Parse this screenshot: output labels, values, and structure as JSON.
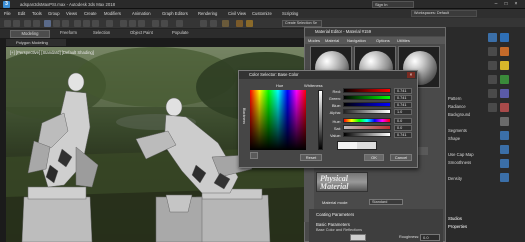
{
  "window": {
    "title": "adspan3dsMaxPSI.max - Autodesk 3ds Max 2018",
    "sign_in": "Sign In",
    "workspace": "Workspaces: Default",
    "controls": [
      "–",
      "□",
      "×"
    ]
  },
  "menu": [
    "File",
    "Edit",
    "Tools",
    "Group",
    "Views",
    "Create",
    "Modifiers",
    "Animation",
    "Graph Editors",
    "Rendering",
    "Civil View",
    "Customize",
    "Scripting"
  ],
  "toolbar": {
    "create_selection_set": "Create Selection Se"
  },
  "ribbon": {
    "tabs": [
      "Modeling",
      "Freeform",
      "Selection",
      "Object Paint",
      "Populate"
    ],
    "panel_label": "Polygon Modeling"
  },
  "viewport": {
    "label": "[+] [Perspective] [Standard] [Default Shading]"
  },
  "material_editor": {
    "title": "Material Editor - Material #159",
    "menu": [
      "Modes",
      "Material",
      "Navigation",
      "Options",
      "Utilities"
    ],
    "preview_text": "Physical Material",
    "material_mode_label": "Material mode:",
    "material_mode_value": "Standard",
    "rollout_coating": "Coating Parameters",
    "rollout_basic": "Basic Parameters",
    "base_color_label": "Base Color and Reflections",
    "roughness_label": "Roughness:",
    "roughness_value": "0.0"
  },
  "color_selector": {
    "title": "Color Selector: Base Color",
    "hue_label": "Hue",
    "whiteness_label": "Whiteness",
    "blackness_label": "Blackness",
    "channels": [
      {
        "label": "Red:",
        "value": "0.741",
        "color": "#d85050"
      },
      {
        "label": "Green:",
        "value": "0.741",
        "color": "#50c050"
      },
      {
        "label": "Blue:",
        "value": "0.741",
        "color": "#5070d8"
      },
      {
        "label": "Alpha:",
        "value": "1.0",
        "color": "#c0c0c0"
      },
      {
        "label": "Hue:",
        "value": "0.0",
        "color": "#d84040"
      },
      {
        "label": "Sat:",
        "value": "0.0",
        "color": "#909090"
      },
      {
        "label": "Value:",
        "value": "0.741",
        "color": "#b0b0b0"
      }
    ],
    "reset": "Reset",
    "ok": "OK",
    "cancel": "Cancel"
  },
  "command_panel": {
    "items": [
      "Pattern",
      "Radiance",
      "Background",
      "Segments",
      "Shape",
      "Use Cap Map",
      "Smoothness",
      "Density",
      "Studios",
      "Properties"
    ]
  }
}
